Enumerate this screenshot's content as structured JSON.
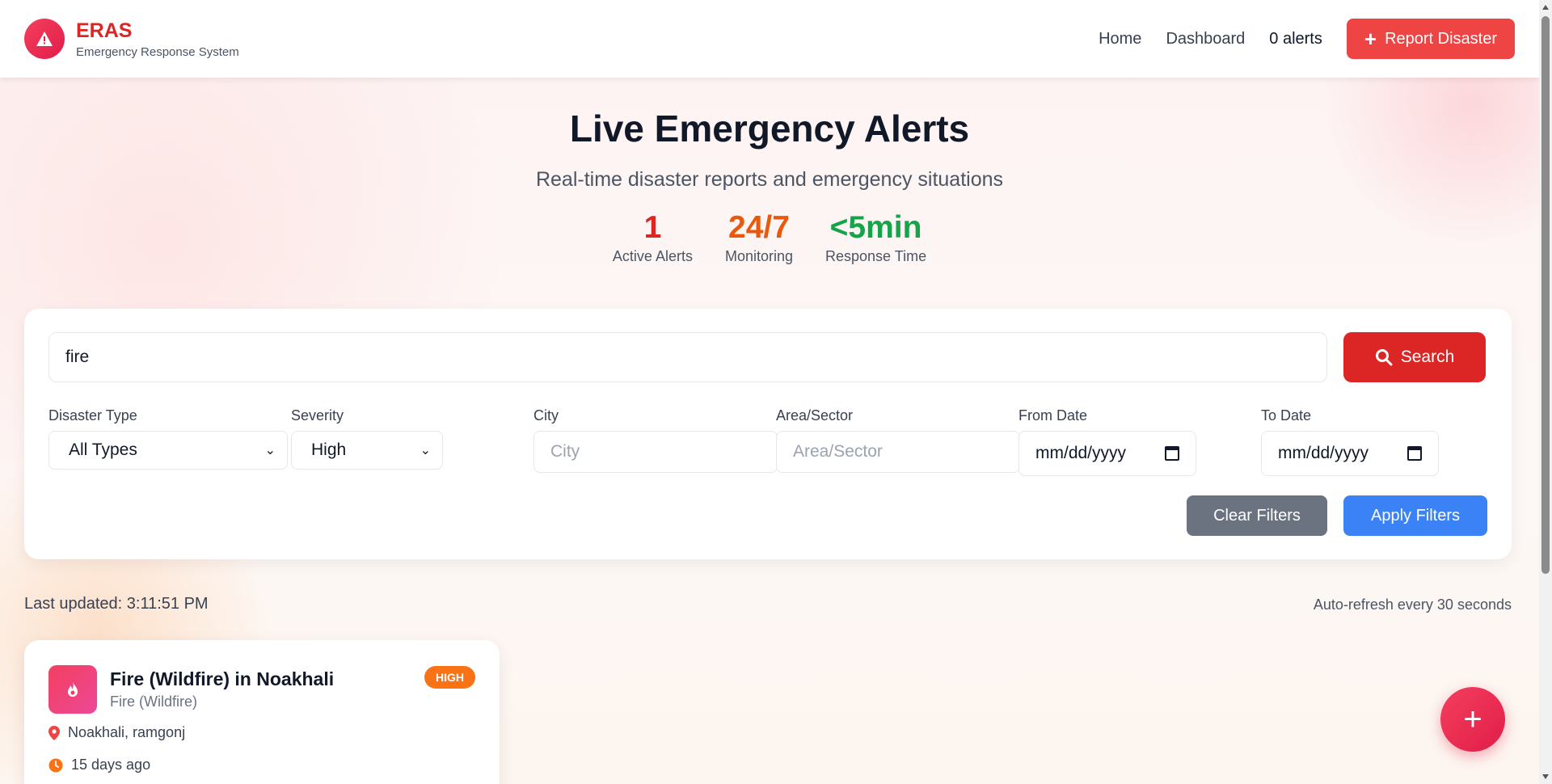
{
  "brand": {
    "name": "ERAS",
    "tagline": "Emergency Response System"
  },
  "nav": {
    "home": "Home",
    "dashboard": "Dashboard",
    "alerts": "0 alerts",
    "report_button": "Report Disaster"
  },
  "hero": {
    "title": "Live Emergency Alerts",
    "subtitle": "Real-time disaster reports and emergency situations",
    "stats": [
      {
        "value": "1",
        "label": "Active Alerts"
      },
      {
        "value": "24/7",
        "label": "Monitoring"
      },
      {
        "value": "<5min",
        "label": "Response Time"
      }
    ]
  },
  "search": {
    "value": "fire",
    "button": "Search"
  },
  "filters": {
    "disaster_type": {
      "label": "Disaster Type",
      "value": "All Types"
    },
    "severity": {
      "label": "Severity",
      "value": "High"
    },
    "city": {
      "label": "City",
      "placeholder": "City"
    },
    "area": {
      "label": "Area/Sector",
      "placeholder": "Area/Sector"
    },
    "from_date": {
      "label": "From Date",
      "placeholder": "mm/dd/yyyy"
    },
    "to_date": {
      "label": "To Date",
      "placeholder": "mm/dd/yyyy"
    },
    "clear_button": "Clear Filters",
    "apply_button": "Apply Filters"
  },
  "status": {
    "last_updated": "Last updated: 3:11:51 PM",
    "auto_refresh": "Auto-refresh every 30 seconds"
  },
  "alerts": [
    {
      "title": "Fire (Wildfire) in Noakhali",
      "type": "Fire (Wildfire)",
      "severity": "HIGH",
      "location": "Noakhali, ramgonj",
      "time": "15 days ago"
    }
  ],
  "fab": {
    "label": "+"
  },
  "colors": {
    "brand_red": "#dc2626",
    "accent_orange": "#ea580c",
    "accent_green": "#16a34a",
    "apply_blue": "#3b82f6"
  },
  "icons": [
    "warning-icon",
    "plus-icon",
    "search-icon",
    "calendar-icon",
    "fire-icon",
    "location-pin-icon",
    "clock-icon"
  ]
}
